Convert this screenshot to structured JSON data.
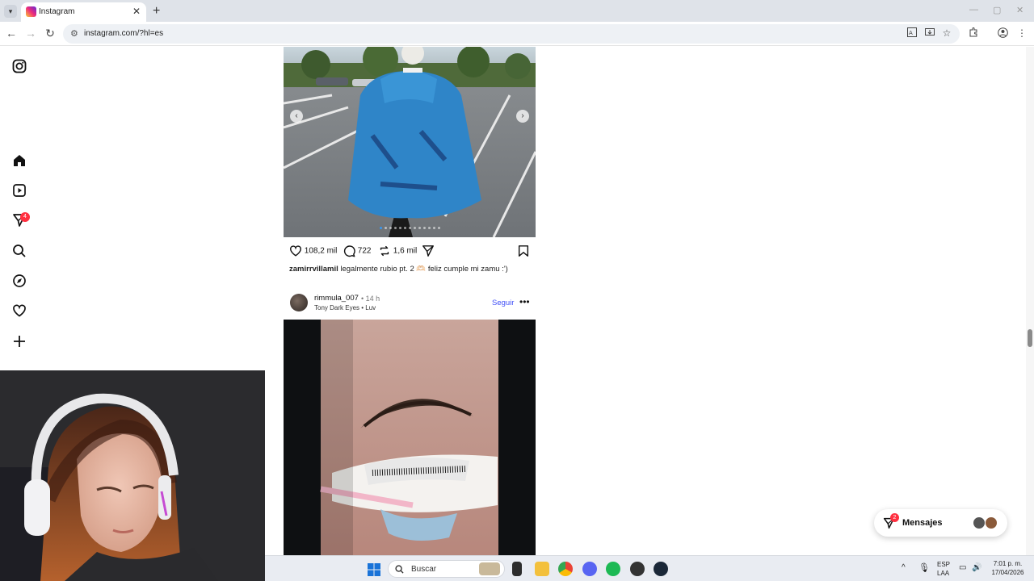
{
  "browser": {
    "tab_list_label": "▾",
    "tab_title": "Instagram",
    "tab_close": "✕",
    "new_tab": "+",
    "window_controls": {
      "minimize": "—",
      "maximize": "▢",
      "close": "✕"
    },
    "nav": {
      "back": "←",
      "forward": "→",
      "reload": "↻"
    },
    "url": "instagram.com/?hl=es",
    "toolbar_icons": [
      "translate-icon",
      "install-icon",
      "star-icon",
      "extensions-icon",
      "profile-icon",
      "menu-icon"
    ]
  },
  "sidebar": {
    "notifications_badge": "4",
    "items": [
      "instagram-logo-icon",
      "home-icon",
      "reels-icon",
      "messages-icon",
      "search-icon",
      "explore-icon",
      "heart-icon",
      "create-icon"
    ]
  },
  "post1": {
    "prev": "‹",
    "next": "›",
    "likes": "108,2 mil",
    "comments": "722",
    "reposts": "1,6 mil",
    "caption_user": "zamirrvillamil",
    "caption_text": "legalmente rubio pt. 2 🫶🏻 feliz cumple mi zamu :')"
  },
  "post2": {
    "username": "rimmula_007",
    "time": "• 14 h",
    "song": "Tony Dark Eyes • Luv",
    "follow": "Seguir",
    "more": "•••"
  },
  "messages": {
    "label": "Mensajes",
    "badge": "2"
  },
  "taskbar": {
    "search_label": "Buscar",
    "lang_top": "ESP",
    "lang_bottom": "LAA",
    "time": "7:01 p. m.",
    "date": "17/04/2026"
  },
  "colors": {
    "accent_blue": "#4150f7",
    "badge_red": "#ff3040",
    "chrome_bg": "#dfe3e9"
  }
}
